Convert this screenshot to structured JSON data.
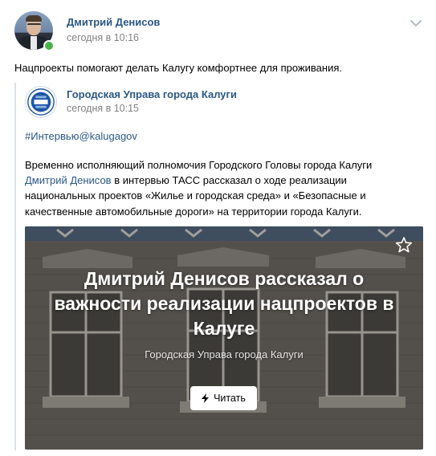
{
  "post": {
    "author": "Дмитрий Денисов",
    "time": "сегодня в 10:16",
    "text": "Нацпроекты помогают делать Калугу комфортнее для проживания."
  },
  "repost": {
    "author": "Городская Управа города Калуги",
    "time": "сегодня в 10:15",
    "hashtag": "#Интервью@kalugagov",
    "body_line1": "Временно исполняющий полномочия Городского Головы города Калуги",
    "body_link": "Дмитрий Денисов",
    "body_line2_rest": " в интервью ТАСС рассказал о ходе реализации",
    "body_line3": "национальных проектов «Жилье и городская среда» и «Безопасные и",
    "body_line4": "качественные автомобильные дороги» на территории города Калуги."
  },
  "card": {
    "title_line1": "Дмитрий Денисов рассказал о",
    "title_line2": "важности реализации нацпроектов в",
    "title_line3": "Калуге",
    "source": "Городская Управа города Калуги",
    "button_label": "Читать"
  },
  "colors": {
    "link": "#2a5885",
    "meta": "#828282",
    "online": "#4bb34b",
    "repost_bar": "#dae1e8"
  },
  "icons": {
    "menu": "chevron-down-icon",
    "bookmark": "star-icon",
    "instant_view": "lightning-icon",
    "online": "online-dot"
  }
}
